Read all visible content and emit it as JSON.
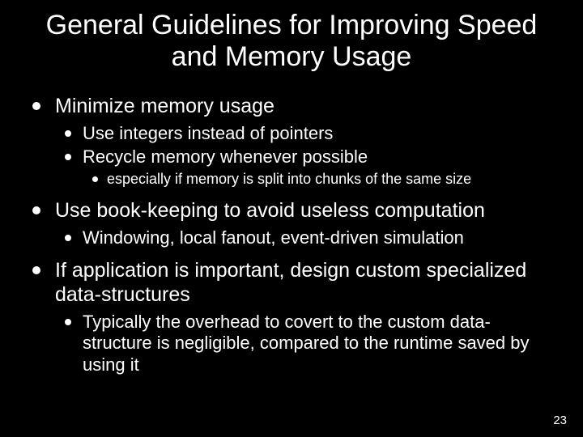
{
  "title": "General Guidelines for Improving Speed and Memory Usage",
  "b1": {
    "text": "Minimize memory usage",
    "sub": {
      "a": "Use integers instead of pointers",
      "b": "Recycle memory whenever possible",
      "b_sub": "especially if memory is split into chunks of the same size"
    }
  },
  "b2": {
    "text": "Use book-keeping to avoid useless computation",
    "sub": {
      "a": "Windowing, local fanout, event-driven simulation"
    }
  },
  "b3": {
    "text": "If application is important, design custom specialized data-structures",
    "sub": {
      "a": "Typically the overhead to covert to the custom data-structure is negligible, compared to the runtime saved by using it"
    }
  },
  "page_number": "23"
}
